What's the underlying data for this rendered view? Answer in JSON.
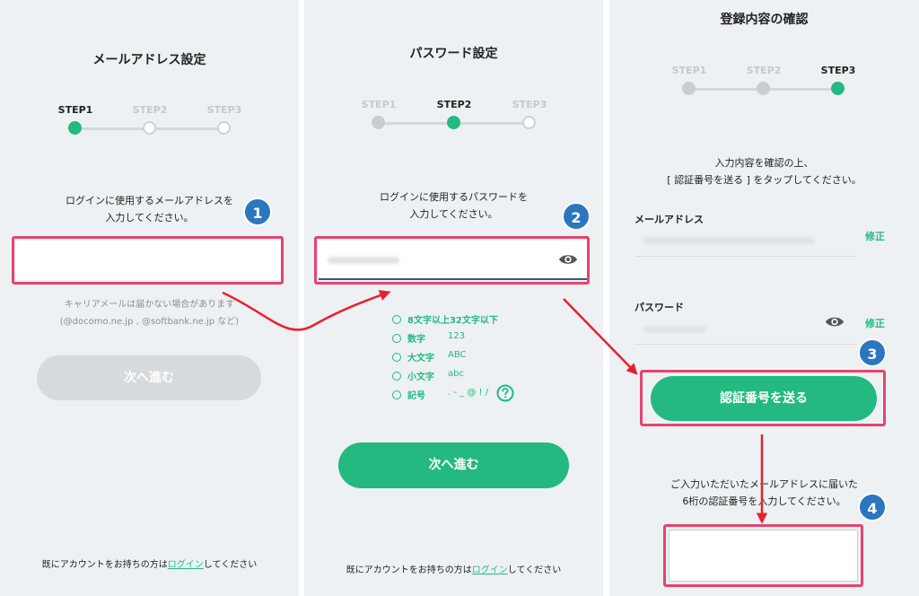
{
  "steps": [
    "STEP1",
    "STEP2",
    "STEP3"
  ],
  "panel1": {
    "title": "メールアドレス設定",
    "instruction": [
      "ログインに使用するメールアドレスを",
      "入力してください。"
    ],
    "email_value": "",
    "carrier_note": [
      "キャリアメールは届かない場合があります",
      "(@docomo.ne.jp , @softbank.ne.jp など)"
    ],
    "next_label": "次へ進む",
    "footer_prefix": "既にアカウントをお持ちの方は",
    "footer_link": "ログイン",
    "footer_suffix": "してください"
  },
  "panel2": {
    "title": "パスワード設定",
    "instruction": [
      "ログインに使用するパスワードを",
      "入力してください。"
    ],
    "requirements": [
      {
        "label": "8文字以上32文字以下",
        "example": ""
      },
      {
        "label": "数字",
        "example": "123"
      },
      {
        "label": "大文字",
        "example": "ABC"
      },
      {
        "label": "小文字",
        "example": "abc"
      },
      {
        "label": "記号",
        "example": ". - _ @ ! /"
      }
    ],
    "next_label": "次へ進む",
    "footer_prefix": "既にアカウントをお持ちの方は",
    "footer_link": "ログイン",
    "footer_suffix": "してください"
  },
  "panel3": {
    "title": "登録内容の確認",
    "instruction": [
      "入力内容を確認の上、",
      "[ 認証番号を送る ] をタップしてください。"
    ],
    "email_label": "メールアドレス",
    "password_label": "パスワード",
    "edit_label": "修正",
    "send_label": "認証番号を送る",
    "code_instruction": [
      "ご入力いただいたメールアドレスに届いた",
      "6桁の認証番号を入力してください。"
    ],
    "code_value": ""
  },
  "badges": [
    "1",
    "2",
    "3",
    "4"
  ],
  "colors": {
    "accent": "#23b981",
    "highlight": "#e4446e",
    "badge": "#2b76be",
    "arrow": "#e8202f"
  },
  "icons": {
    "eye": "eye-icon",
    "help": "question-circle-icon"
  }
}
